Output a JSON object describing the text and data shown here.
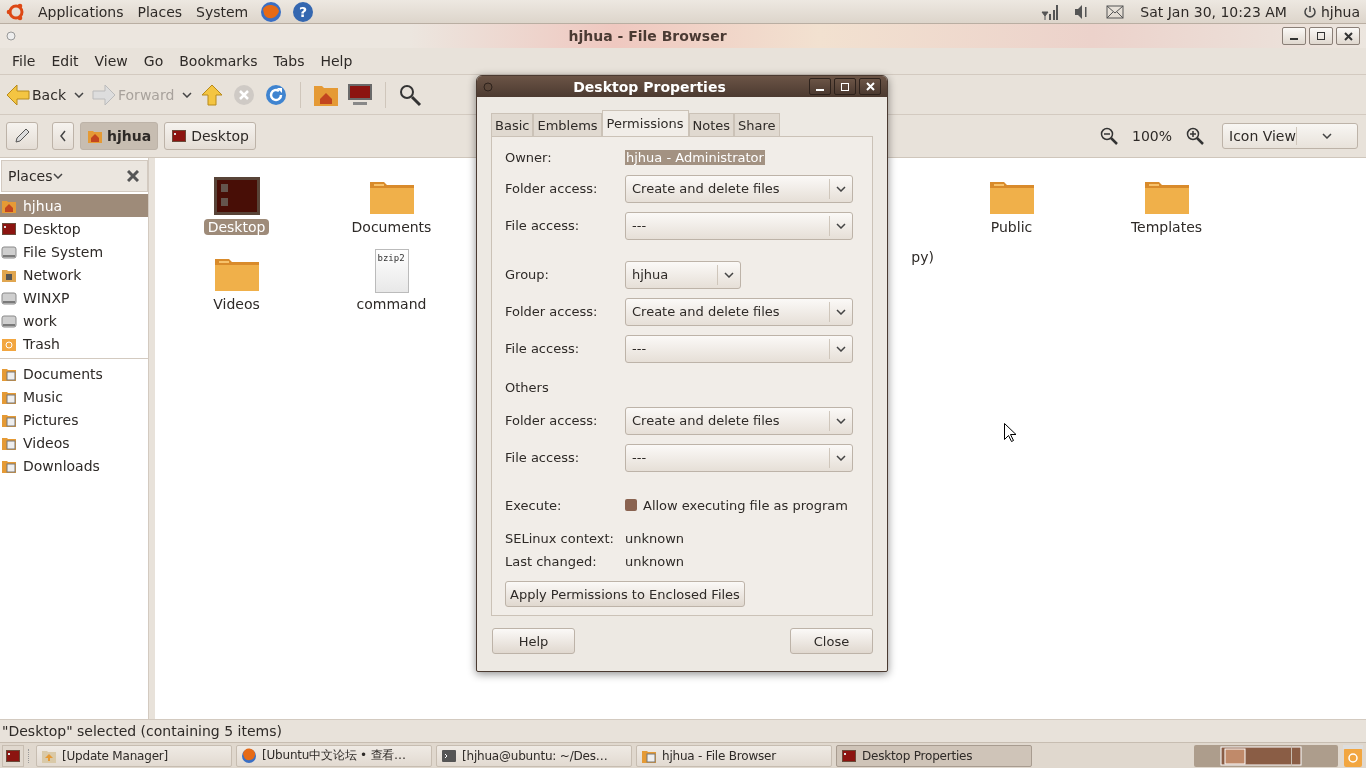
{
  "top_panel": {
    "menus": [
      "Applications",
      "Places",
      "System"
    ],
    "help_glyph": "?",
    "clock": "Sat Jan 30, 10:23 AM",
    "user": "hjhua"
  },
  "window": {
    "title": "hjhua - File Browser",
    "menu": [
      "File",
      "Edit",
      "View",
      "Go",
      "Bookmarks",
      "Tabs",
      "Help"
    ],
    "toolbar": {
      "back": {
        "label": "Back",
        "disabled": false
      },
      "forward": {
        "label": "Forward",
        "disabled": true
      },
      "stop": {
        "disabled": true
      }
    },
    "path": [
      {
        "label": "hjhua",
        "selected": true
      },
      {
        "label": "Desktop",
        "selected": false
      }
    ],
    "zoom": "100%",
    "view_mode": "Icon View",
    "sidebar": {
      "title": "Places",
      "groups": [
        [
          {
            "label": "hjhua",
            "kind": "home",
            "selected": true
          },
          {
            "label": "Desktop",
            "kind": "desktop",
            "selected": false
          },
          {
            "label": "File System",
            "kind": "drive",
            "selected": false
          },
          {
            "label": "Network",
            "kind": "network",
            "selected": false
          },
          {
            "label": "WINXP",
            "kind": "drive",
            "selected": false
          },
          {
            "label": "work",
            "kind": "drive",
            "selected": false
          },
          {
            "label": "Trash",
            "kind": "trash",
            "selected": false
          }
        ],
        [
          {
            "label": "Documents",
            "kind": "folder",
            "selected": false
          },
          {
            "label": "Music",
            "kind": "folder",
            "selected": false
          },
          {
            "label": "Pictures",
            "kind": "folder",
            "selected": false
          },
          {
            "label": "Videos",
            "kind": "folder",
            "selected": false
          },
          {
            "label": "Downloads",
            "kind": "folder",
            "selected": false
          }
        ]
      ]
    },
    "files": [
      {
        "name": "Desktop",
        "kind": "desktop",
        "selected": true
      },
      {
        "name": "Documents",
        "kind": "folder",
        "selected": false
      },
      {
        "name": "Public",
        "kind": "folder",
        "selected": false
      },
      {
        "name": "Templates",
        "kind": "folder",
        "selected": false
      },
      {
        "name": "Videos",
        "kind": "folder",
        "selected": false
      },
      {
        "name": "command",
        "kind": "file",
        "badge": "bzip2",
        "selected": false
      },
      {
        "name": "py)",
        "kind": "partial"
      }
    ],
    "status": "\"Desktop\" selected (containing 5 items)"
  },
  "dialog": {
    "title": "Desktop Properties",
    "tabs": [
      {
        "label": "Basic",
        "selected": false
      },
      {
        "label": "Emblems",
        "selected": false
      },
      {
        "label": "Permissions",
        "selected": true
      },
      {
        "label": "Notes",
        "selected": false
      },
      {
        "label": "Share",
        "selected": false
      }
    ],
    "rows": [
      {
        "kind": "owner",
        "label": "Owner:",
        "value": "hjhua - Administrator"
      },
      {
        "kind": "combo",
        "label": "Folder access:",
        "value": "Create and delete files"
      },
      {
        "kind": "combo",
        "label": "File access:",
        "value": "---"
      },
      {
        "kind": "group",
        "label": "Group:",
        "value": "hjhua"
      },
      {
        "kind": "combo",
        "label": "Folder access:",
        "value": "Create and delete files"
      },
      {
        "kind": "combo",
        "label": "File access:",
        "value": "---"
      },
      {
        "kind": "heading",
        "label": "Others"
      },
      {
        "kind": "combo",
        "label": "Folder access:",
        "value": "Create and delete files"
      },
      {
        "kind": "combo",
        "label": "File access:",
        "value": "---"
      },
      {
        "kind": "checkbox",
        "label": "Execute:",
        "value": "Allow executing file as program",
        "checked": false
      },
      {
        "kind": "info",
        "label": "SELinux context:",
        "value": "unknown"
      },
      {
        "kind": "info",
        "label": "Last changed:",
        "value": "unknown"
      },
      {
        "kind": "button",
        "label": "Apply Permissions to Enclosed Files"
      }
    ],
    "buttons": [
      "Help",
      "Close"
    ]
  },
  "taskbar": {
    "tasks": [
      {
        "label": "[Update Manager]",
        "kind": "update",
        "selected": false
      },
      {
        "label": "[Ubuntu中文论坛 • 查看…",
        "kind": "browser",
        "selected": false
      },
      {
        "label": "[hjhua@ubuntu: ~/Des…",
        "kind": "terminal",
        "selected": false
      },
      {
        "label": "hjhua - File Browser",
        "kind": "folder",
        "selected": false
      },
      {
        "label": "Desktop Properties",
        "kind": "properties",
        "selected": true
      }
    ]
  }
}
